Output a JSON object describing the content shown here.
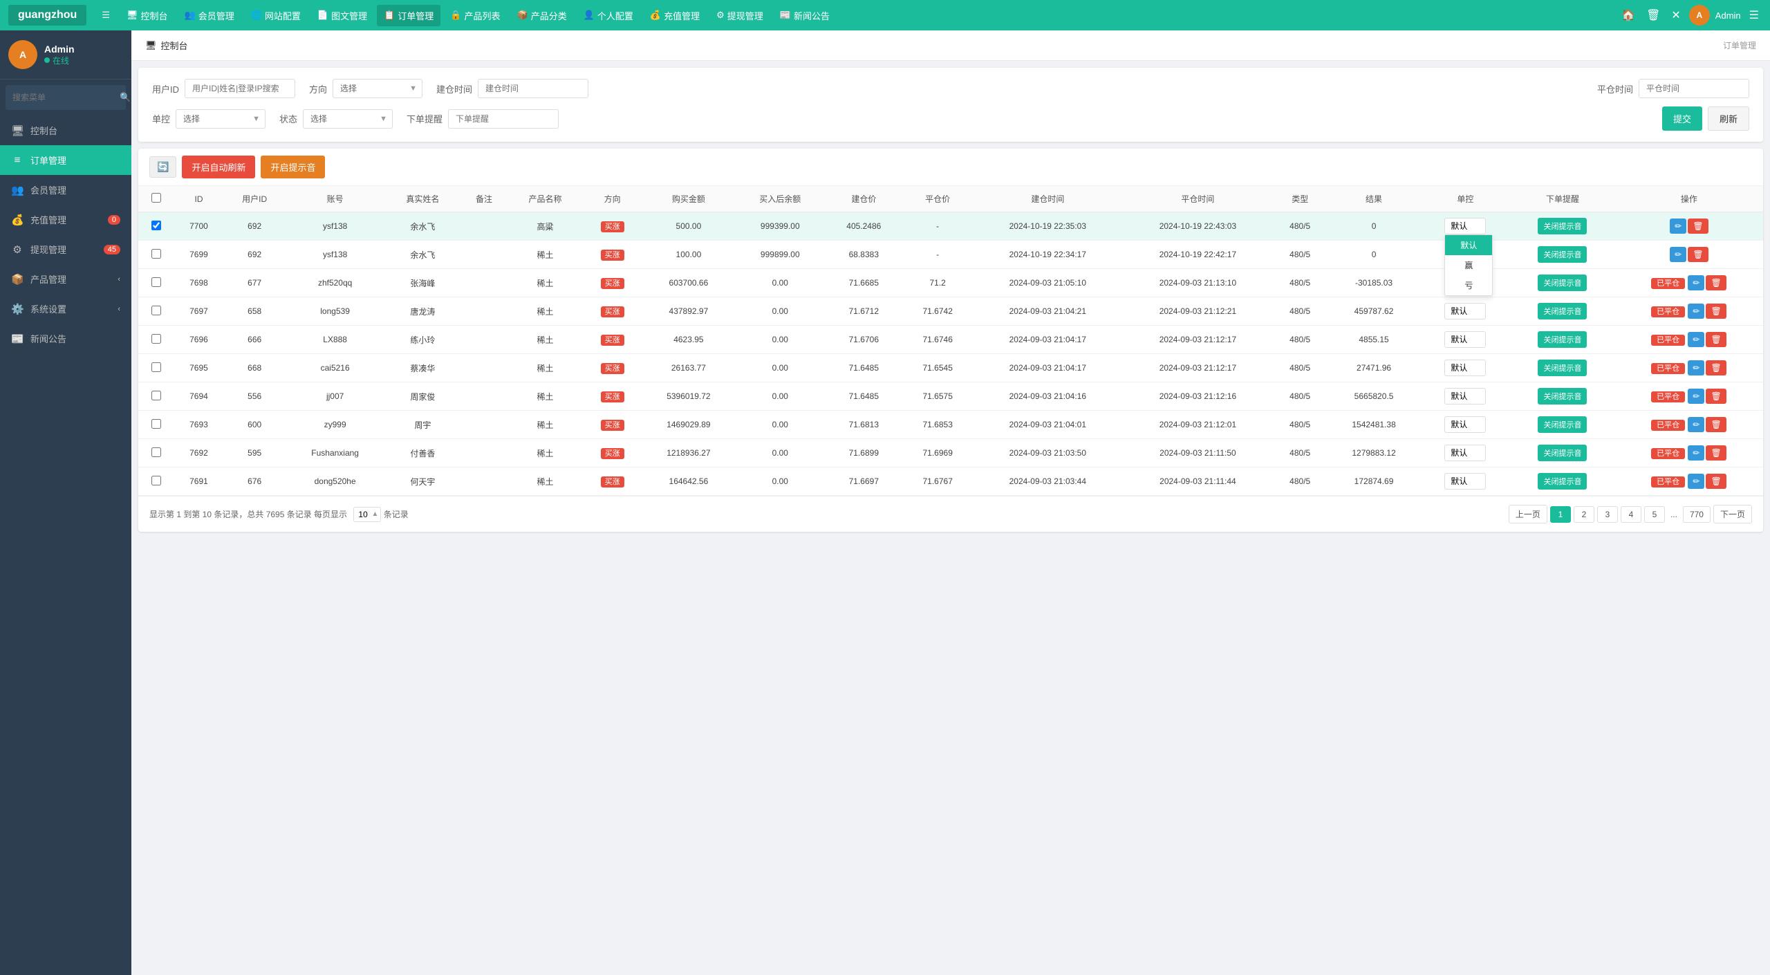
{
  "app": {
    "logo": "guangzhou",
    "nav_items": [
      {
        "id": "menu",
        "icon": "☰",
        "label": ""
      },
      {
        "id": "dashboard",
        "icon": "🖥",
        "label": "控制台"
      },
      {
        "id": "members",
        "icon": "👥",
        "label": "会员管理"
      },
      {
        "id": "site-config",
        "icon": "🌐",
        "label": "网站配置"
      },
      {
        "id": "article",
        "icon": "📄",
        "label": "图文管理"
      },
      {
        "id": "orders",
        "icon": "📋",
        "label": "订单管理",
        "active": true
      },
      {
        "id": "products",
        "icon": "🔒",
        "label": "产品列表"
      },
      {
        "id": "categories",
        "icon": "📦",
        "label": "产品分类"
      },
      {
        "id": "personal",
        "icon": "👤",
        "label": "个人配置"
      },
      {
        "id": "recharge",
        "icon": "💰",
        "label": "充值管理"
      },
      {
        "id": "withdraw",
        "icon": "⚙",
        "label": "提现管理"
      },
      {
        "id": "news",
        "icon": "📰",
        "label": "新闻公告"
      }
    ],
    "nav_right": {
      "icons": [
        "🏠",
        "🗑",
        "✕",
        "☰"
      ],
      "admin_label": "Admin"
    }
  },
  "sidebar": {
    "user": {
      "name": "Admin",
      "status": "在线",
      "avatar_letter": "A"
    },
    "search_placeholder": "搜索菜单",
    "menu_items": [
      {
        "id": "dashboard",
        "icon": "🖥",
        "label": "控制台",
        "active": false
      },
      {
        "id": "orders",
        "icon": "📋",
        "label": "订单管理",
        "active": true,
        "badge": null
      },
      {
        "id": "members",
        "icon": "👥",
        "label": "会员管理",
        "active": false
      },
      {
        "id": "recharge",
        "icon": "💰",
        "label": "充值管理",
        "active": false,
        "badge": "0"
      },
      {
        "id": "withdraw",
        "icon": "⚙",
        "label": "提现管理",
        "active": false,
        "badge": "45"
      },
      {
        "id": "product-mgmt",
        "icon": "📦",
        "label": "产品管理",
        "active": false,
        "has_arrow": true
      },
      {
        "id": "system",
        "icon": "⚙️",
        "label": "系统设置",
        "active": false,
        "has_arrow": true
      },
      {
        "id": "news-pub",
        "icon": "📰",
        "label": "新闻公告",
        "active": false
      }
    ]
  },
  "page": {
    "breadcrumb_icon": "🖥",
    "breadcrumb_text": "控制台",
    "title_right": "订单管理"
  },
  "filters": {
    "user_id_label": "用户ID",
    "user_id_placeholder": "用户ID|姓名|登录IP搜索",
    "direction_label": "方向",
    "direction_placeholder": "选择",
    "build_time_label": "建仓时间",
    "build_time_placeholder": "建仓时间",
    "close_time_label": "平仓时间",
    "close_time_placeholder": "平仓时间",
    "single_control_label": "单控",
    "single_control_placeholder": "选择",
    "status_label": "状态",
    "status_placeholder": "选择",
    "order_reminder_label": "下单提醒",
    "order_reminder_placeholder": "下单提醒",
    "submit_label": "提交",
    "refresh_label": "刷新"
  },
  "toolbar": {
    "refresh_icon": "🔄",
    "auto_refresh_label": "开启自动刷新",
    "sound_label": "开启提示音"
  },
  "table": {
    "columns": [
      "",
      "ID",
      "用户ID",
      "账号",
      "真实姓名",
      "备注",
      "产品名称",
      "方向",
      "购买金额",
      "买入后余额",
      "建仓价",
      "平仓价",
      "建仓时间",
      "平仓时间",
      "类型",
      "结果",
      "单控",
      "下单提醒",
      "操作"
    ],
    "rows": [
      {
        "id": "7700",
        "user_id": "692",
        "account": "ysf138",
        "real_name": "余水飞",
        "remark": "",
        "product": "高粱",
        "direction": "买涨",
        "buy_amount": "500.00",
        "balance_after": "999399.00",
        "build_price": "405.2486",
        "close_price": "-",
        "build_time": "2024-10-19 22:35:03",
        "close_time": "2024-10-19 22:43:03",
        "type": "480/5",
        "result": "0",
        "single_ctrl": "默认",
        "reminder": "关闭提示音",
        "selected": true,
        "show_dropdown": true,
        "dropdown_options": [
          "默认",
          "赢",
          "亏"
        ]
      },
      {
        "id": "7699",
        "user_id": "692",
        "account": "ysf138",
        "real_name": "余水飞",
        "remark": "",
        "product": "稀土",
        "direction": "买涨",
        "buy_amount": "100.00",
        "balance_after": "999899.00",
        "build_price": "68.8383",
        "close_price": "-",
        "build_time": "2024-10-19 22:34:17",
        "close_time": "2024-10-19 22:42:17",
        "type": "480/5",
        "result": "0",
        "single_ctrl": "默认",
        "reminder": "关闭提示音",
        "selected": false,
        "show_dropdown": false,
        "dropdown_options": [
          "默认",
          "赢",
          "亏"
        ]
      },
      {
        "id": "7698",
        "user_id": "677",
        "account": "zhf520qq",
        "real_name": "张海峰",
        "remark": "",
        "product": "稀土",
        "direction": "买涨",
        "buy_amount": "603700.66",
        "balance_after": "0.00",
        "build_price": "71.6685",
        "close_price": "71.2",
        "build_time": "2024-09-03 21:05:10",
        "close_time": "2024-09-03 21:13:10",
        "type": "480/5",
        "result": "-30185.03",
        "single_ctrl": "默认",
        "reminder": "关闭提示音",
        "selected": false,
        "show_dropdown": false,
        "settled": true
      },
      {
        "id": "7697",
        "user_id": "658",
        "account": "long539",
        "real_name": "唐龙涛",
        "remark": "",
        "product": "稀土",
        "direction": "买涨",
        "buy_amount": "437892.97",
        "balance_after": "0.00",
        "build_price": "71.6712",
        "close_price": "71.6742",
        "build_time": "2024-09-03 21:04:21",
        "close_time": "2024-09-03 21:12:21",
        "type": "480/5",
        "result": "459787.62",
        "single_ctrl": "默认",
        "reminder": "关闭提示音",
        "selected": false,
        "show_dropdown": false,
        "settled": true
      },
      {
        "id": "7696",
        "user_id": "666",
        "account": "LX888",
        "real_name": "练小玲",
        "remark": "",
        "product": "稀土",
        "direction": "买涨",
        "buy_amount": "4623.95",
        "balance_after": "0.00",
        "build_price": "71.6706",
        "close_price": "71.6746",
        "build_time": "2024-09-03 21:04:17",
        "close_time": "2024-09-03 21:12:17",
        "type": "480/5",
        "result": "4855.15",
        "single_ctrl": "默认",
        "reminder": "关闭提示音",
        "selected": false,
        "show_dropdown": false,
        "settled": true
      },
      {
        "id": "7695",
        "user_id": "668",
        "account": "cai5216",
        "real_name": "蔡凑华",
        "remark": "",
        "product": "稀土",
        "direction": "买涨",
        "buy_amount": "26163.77",
        "balance_after": "0.00",
        "build_price": "71.6485",
        "close_price": "71.6545",
        "build_time": "2024-09-03 21:04:17",
        "close_time": "2024-09-03 21:12:17",
        "type": "480/5",
        "result": "27471.96",
        "single_ctrl": "默认",
        "reminder": "关闭提示音",
        "selected": false,
        "show_dropdown": false,
        "settled": true
      },
      {
        "id": "7694",
        "user_id": "556",
        "account": "jj007",
        "real_name": "周家俊",
        "remark": "",
        "product": "稀土",
        "direction": "买涨",
        "buy_amount": "5396019.72",
        "balance_after": "0.00",
        "build_price": "71.6485",
        "close_price": "71.6575",
        "build_time": "2024-09-03 21:04:16",
        "close_time": "2024-09-03 21:12:16",
        "type": "480/5",
        "result": "5665820.5",
        "single_ctrl": "默认",
        "reminder": "关闭提示音",
        "selected": false,
        "show_dropdown": false,
        "settled": true
      },
      {
        "id": "7693",
        "user_id": "600",
        "account": "zy999",
        "real_name": "周宇",
        "remark": "",
        "product": "稀土",
        "direction": "买涨",
        "buy_amount": "1469029.89",
        "balance_after": "0.00",
        "build_price": "71.6813",
        "close_price": "71.6853",
        "build_time": "2024-09-03 21:04:01",
        "close_time": "2024-09-03 21:12:01",
        "type": "480/5",
        "result": "1542481.38",
        "single_ctrl": "默认",
        "reminder": "关闭提示音",
        "selected": false,
        "show_dropdown": false,
        "settled": true
      },
      {
        "id": "7692",
        "user_id": "595",
        "account": "Fushanxiang",
        "real_name": "付善香",
        "remark": "",
        "product": "稀土",
        "direction": "买涨",
        "buy_amount": "1218936.27",
        "balance_after": "0.00",
        "build_price": "71.6899",
        "close_price": "71.6969",
        "build_time": "2024-09-03 21:03:50",
        "close_time": "2024-09-03 21:11:50",
        "type": "480/5",
        "result": "1279883.12",
        "single_ctrl": "默认",
        "reminder": "关闭提示音",
        "selected": false,
        "show_dropdown": false,
        "settled": true
      },
      {
        "id": "7691",
        "user_id": "676",
        "account": "dong520he",
        "real_name": "何天宇",
        "remark": "",
        "product": "稀土",
        "direction": "买涨",
        "buy_amount": "164642.56",
        "balance_after": "0.00",
        "build_price": "71.6697",
        "close_price": "71.6767",
        "build_time": "2024-09-03 21:03:44",
        "close_time": "2024-09-03 21:11:44",
        "type": "480/5",
        "result": "172874.69",
        "single_ctrl": "默认",
        "reminder": "关闭提示音",
        "selected": false,
        "show_dropdown": false,
        "settled": true
      }
    ]
  },
  "pagination": {
    "info": "显示第 1 到第 10 条记录，总共 7695 条记录 每页显示",
    "per_page": "10",
    "per_page_suffix": "条记录",
    "prev_label": "上一页",
    "next_label": "下一页",
    "pages": [
      "1",
      "2",
      "3",
      "4",
      "5",
      "...",
      "770"
    ],
    "current_page": "1"
  },
  "direction_tag": "买涨",
  "close_notification_label": "关闭提示音",
  "settled_label": "已平仓"
}
